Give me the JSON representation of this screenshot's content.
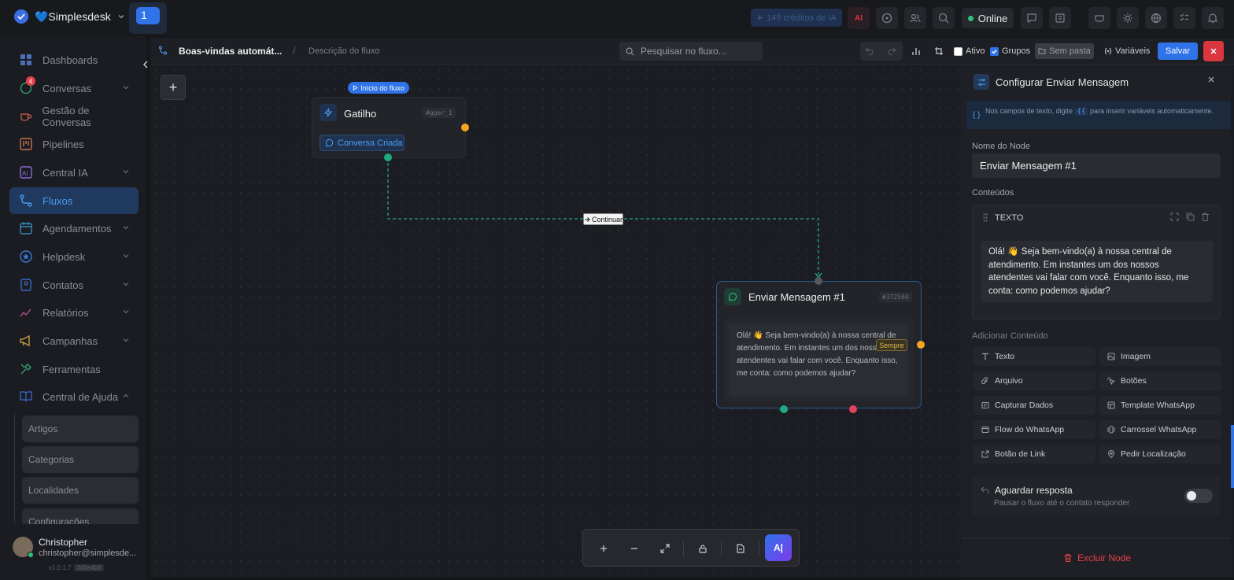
{
  "topbar": {
    "brand": "💙Simplesdesk",
    "workspace_badge": "1",
    "credits": "149 créditos de IA",
    "online": "Online"
  },
  "sidebar": {
    "items": [
      {
        "label": "Dashboards"
      },
      {
        "label": "Conversas",
        "badge": "4"
      },
      {
        "label": "Gestão de Conversas"
      },
      {
        "label": "Pipelines"
      },
      {
        "label": "Central IA"
      },
      {
        "label": "Fluxos"
      },
      {
        "label": "Agendamentos"
      },
      {
        "label": "Helpdesk"
      },
      {
        "label": "Contatos"
      },
      {
        "label": "Relatórios"
      },
      {
        "label": "Campanhas"
      },
      {
        "label": "Ferramentas"
      },
      {
        "label": "Central de Ajuda"
      }
    ],
    "sub_items": [
      "Artigos",
      "Categorias",
      "Localidades",
      "Configurações"
    ],
    "user": {
      "name": "Christopher",
      "email": "christopher@simplesde...",
      "version": "v1.0.1.7",
      "hash": "3d0e4b8"
    }
  },
  "flow_bar": {
    "title": "Boas-vindas automát...",
    "separator": "/",
    "description": "Descrição do fluxo",
    "search_placeholder": "Pesquisar no fluxo...",
    "ativo": "Ativo",
    "grupos": "Grupos",
    "sem_pasta": "Sem pasta",
    "variaveis": "Variáveis",
    "salvar": "Salvar",
    "ativo_checked": false,
    "grupos_checked": true
  },
  "canvas": {
    "start_tag": "Início do fluxo",
    "trigger": {
      "title": "Gatilho",
      "id": "#gger_1",
      "tag": "Conversa Criada"
    },
    "edge_label": "Continuar",
    "message_node": {
      "title": "Enviar Mensagem #1",
      "id": "#372504",
      "text": "Olá! 👋 Seja bem-vindo(a) à nossa central de atendimento. Em instantes um dos nossos atendentes vai falar com você. Enquanto isso, me conta: como podemos ajudar?",
      "badge": "Sempre"
    }
  },
  "panel": {
    "title": "Configurar Enviar Mensagem",
    "hint_before": "Nos campos de texto, digite",
    "hint_code": "{{",
    "hint_after": "para inserir variáveis automaticamente.",
    "node_name_label": "Nome do Node",
    "node_name_value": "Enviar Mensagem #1",
    "contents_label": "Conteúdos",
    "content_type": "TEXTO",
    "content_text": "Olá! 👋 Seja bem-vindo(a) à nossa central de atendimento. Em instantes um dos nossos atendentes vai falar com você. Enquanto isso, me conta: como podemos ajudar?",
    "add_content_label": "Adicionar Conteúdo",
    "add_buttons": [
      "Texto",
      "Imagem",
      "Arquivo",
      "Botões",
      "Capturar Dados",
      "Template WhatsApp",
      "Flow do WhatsApp",
      "Carrossel WhatsApp",
      "Botão de Link",
      "Pedir Localização"
    ],
    "wait_title": "Aguardar resposta",
    "wait_sub": "Pausar o fluxo até o contato responder",
    "wait_enabled": false,
    "delete": "Excluir Node"
  },
  "colors": {
    "accent": "#2f73e8",
    "success": "#2ec27e",
    "danger": "#e5414a",
    "port_orange": "#f5a524",
    "port_teal": "#1fa97f",
    "port_pink": "#e5415f"
  }
}
